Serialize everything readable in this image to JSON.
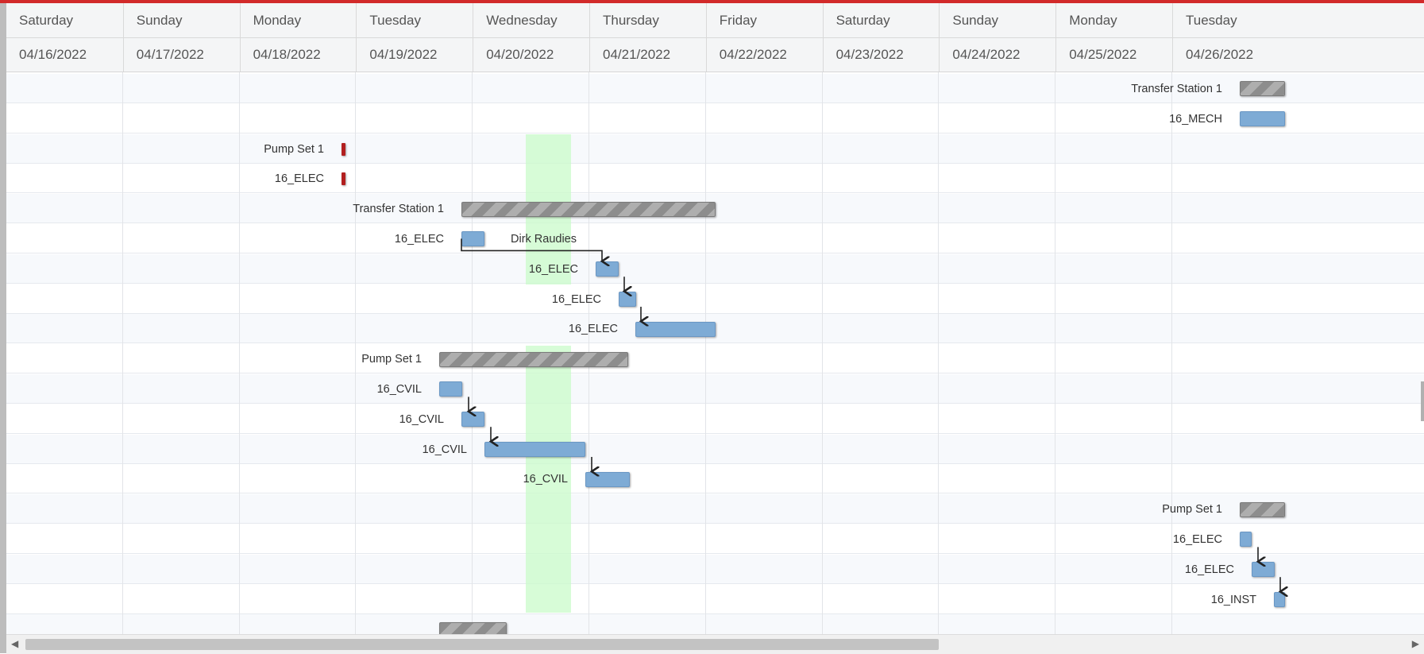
{
  "header": {
    "days": [
      {
        "day": "Saturday",
        "date": "04/16/2022"
      },
      {
        "day": "Sunday",
        "date": "04/17/2022"
      },
      {
        "day": "Monday",
        "date": "04/18/2022"
      },
      {
        "day": "Tuesday",
        "date": "04/19/2022"
      },
      {
        "day": "Wednesday",
        "date": "04/20/2022"
      },
      {
        "day": "Thursday",
        "date": "04/21/2022"
      },
      {
        "day": "Friday",
        "date": "04/22/2022"
      },
      {
        "day": "Saturday",
        "date": "04/23/2022"
      },
      {
        "day": "Sunday",
        "date": "04/24/2022"
      },
      {
        "day": "Monday",
        "date": "04/25/2022"
      },
      {
        "day": "Tuesday",
        "date": "04/26/2022"
      }
    ]
  },
  "rows": [
    {
      "label": "Transfer Station 1",
      "type": "summary"
    },
    {
      "label": "16_MECH",
      "type": "task"
    },
    {
      "label": "Pump Set 1",
      "type": "milestone"
    },
    {
      "label": "16_ELEC",
      "type": "milestone"
    },
    {
      "label": "Transfer Station 1",
      "type": "summary"
    },
    {
      "label": "16_ELEC",
      "type": "task",
      "resource": "Dirk Raudies"
    },
    {
      "label": "16_ELEC",
      "type": "task"
    },
    {
      "label": "16_ELEC",
      "type": "task"
    },
    {
      "label": "16_ELEC",
      "type": "task"
    },
    {
      "label": "Pump Set 1",
      "type": "summary"
    },
    {
      "label": "16_CVIL",
      "type": "task"
    },
    {
      "label": "16_CVIL",
      "type": "task"
    },
    {
      "label": "16_CVIL",
      "type": "task"
    },
    {
      "label": "16_CVIL",
      "type": "task"
    },
    {
      "label": "Pump Set 1",
      "type": "summary"
    },
    {
      "label": "16_ELEC",
      "type": "task"
    },
    {
      "label": "16_ELEC",
      "type": "task"
    },
    {
      "label": "16_INST",
      "type": "task"
    }
  ],
  "colors": {
    "accent": "#d22a2a",
    "task": "#7eabd5",
    "summary": "#8d8d8d",
    "milestone": "#b21f1f",
    "nonworking": "#c9fbc9"
  },
  "icons": {
    "scroll_left": "triangle-left-icon",
    "scroll_right": "triangle-right-icon"
  }
}
